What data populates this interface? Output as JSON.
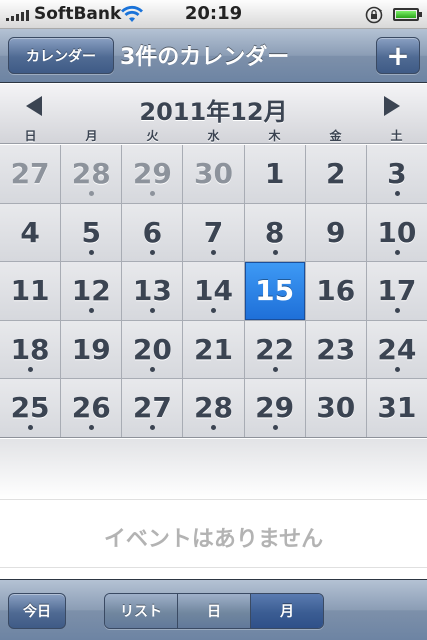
{
  "status_bar": {
    "carrier": "SoftBank",
    "time": "20:19"
  },
  "nav": {
    "calendars_button": "カレンダー",
    "title": "3件のカレンダー",
    "add_button": "+"
  },
  "month": {
    "title": "2011年12月",
    "weekdays": [
      "日",
      "月",
      "火",
      "水",
      "木",
      "金",
      "土"
    ]
  },
  "days": [
    {
      "n": "27",
      "other": true,
      "dot": false
    },
    {
      "n": "28",
      "other": true,
      "dot": true
    },
    {
      "n": "29",
      "other": true,
      "dot": true
    },
    {
      "n": "30",
      "other": true,
      "dot": false
    },
    {
      "n": "1",
      "other": false,
      "dot": false
    },
    {
      "n": "2",
      "other": false,
      "dot": false
    },
    {
      "n": "3",
      "other": false,
      "dot": true
    },
    {
      "n": "4",
      "other": false,
      "dot": false
    },
    {
      "n": "5",
      "other": false,
      "dot": true
    },
    {
      "n": "6",
      "other": false,
      "dot": true
    },
    {
      "n": "7",
      "other": false,
      "dot": true
    },
    {
      "n": "8",
      "other": false,
      "dot": true
    },
    {
      "n": "9",
      "other": false,
      "dot": false
    },
    {
      "n": "10",
      "other": false,
      "dot": true
    },
    {
      "n": "11",
      "other": false,
      "dot": false
    },
    {
      "n": "12",
      "other": false,
      "dot": true
    },
    {
      "n": "13",
      "other": false,
      "dot": true
    },
    {
      "n": "14",
      "other": false,
      "dot": true
    },
    {
      "n": "15",
      "other": false,
      "dot": false,
      "selected": true
    },
    {
      "n": "16",
      "other": false,
      "dot": false
    },
    {
      "n": "17",
      "other": false,
      "dot": true
    },
    {
      "n": "18",
      "other": false,
      "dot": true
    },
    {
      "n": "19",
      "other": false,
      "dot": false
    },
    {
      "n": "20",
      "other": false,
      "dot": true
    },
    {
      "n": "21",
      "other": false,
      "dot": false
    },
    {
      "n": "22",
      "other": false,
      "dot": true
    },
    {
      "n": "23",
      "other": false,
      "dot": false
    },
    {
      "n": "24",
      "other": false,
      "dot": true
    },
    {
      "n": "25",
      "other": false,
      "dot": true
    },
    {
      "n": "26",
      "other": false,
      "dot": true
    },
    {
      "n": "27",
      "other": false,
      "dot": true
    },
    {
      "n": "28",
      "other": false,
      "dot": true
    },
    {
      "n": "29",
      "other": false,
      "dot": true
    },
    {
      "n": "30",
      "other": false,
      "dot": false
    },
    {
      "n": "31",
      "other": false,
      "dot": false
    }
  ],
  "events": {
    "empty_text": "イベントはありません"
  },
  "toolbar": {
    "today_button": "今日",
    "segments": [
      {
        "label": "リスト",
        "active": false
      },
      {
        "label": "日",
        "active": false
      },
      {
        "label": "月",
        "active": true
      }
    ]
  },
  "colors": {
    "selected_day": "#1e6fd8",
    "nav_bar": "#7d90aa",
    "text_dark": "#3b4452"
  },
  "icons": {
    "wifi": "wifi-icon",
    "rotation_lock": "rotation-lock-icon",
    "battery": "battery-icon",
    "prev": "chevron-left-icon",
    "next": "chevron-right-icon"
  }
}
